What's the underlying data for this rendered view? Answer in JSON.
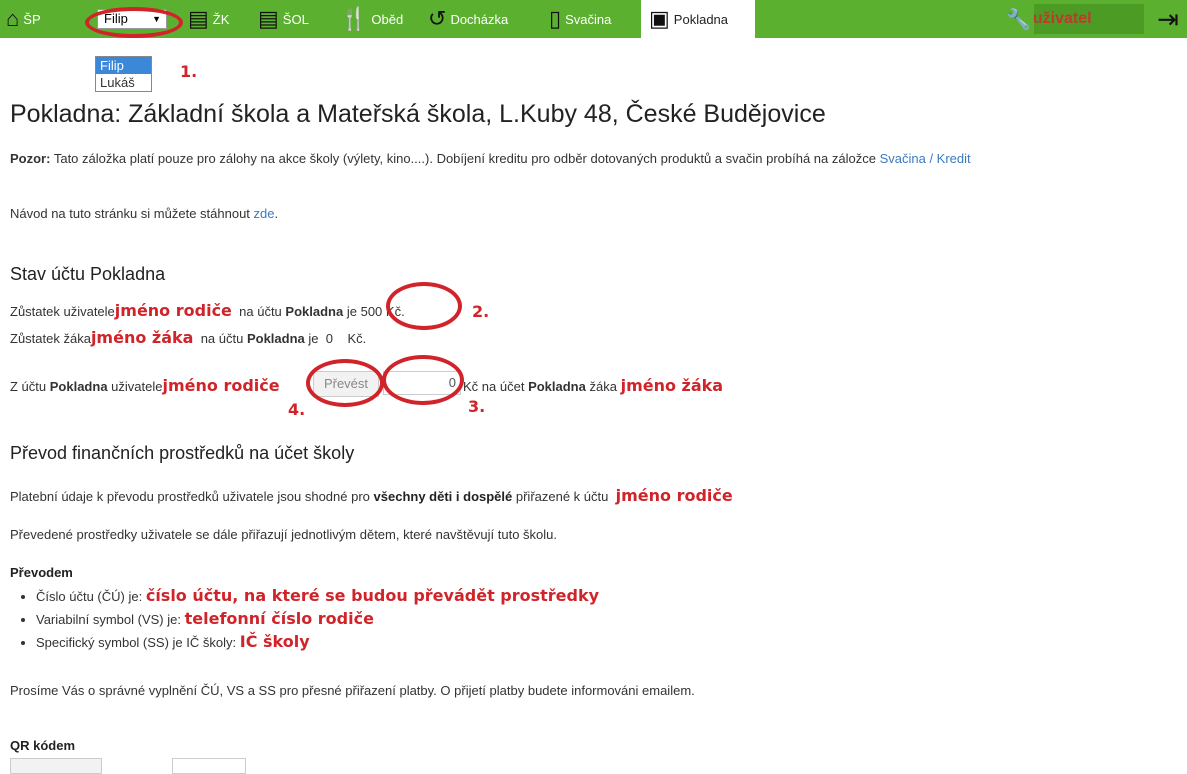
{
  "nav": {
    "home": "ŠP",
    "student_select_value": "Filip",
    "zk": "ŽK",
    "sol": "ŠOL",
    "obed": "Oběd",
    "dochazka": "Docházka",
    "svacina": "Svačina",
    "pokladna": "Pokladna",
    "user": "uživatel",
    "select_options": [
      "Filip",
      "Lukáš"
    ]
  },
  "marks": {
    "m1": "1.",
    "m2": "2.",
    "m3": "3.",
    "m4": "4."
  },
  "page": {
    "title": "Pokladna: Základní škola a Mateřská škola, L.Kuby 48, České Budějovice",
    "warning_label": "Pozor:",
    "warning_text": "Tato záložka platí pouze pro zálohy na akce školy (výlety, kino....). Dobíjení kreditu pro odběr dotovaných produktů a svačin probíhá na záložce",
    "warning_link": "Svačina / Kredit",
    "guide_text": "Návod na tuto stránku si můžete stáhnout",
    "guide_link": "zde",
    "section1_title": "Stav účtu Pokladna",
    "balance_user_prefix": "Zůstatek uživatele",
    "parent_name": "jméno rodiče",
    "on_account": "na účtu",
    "account_name": "Pokladna",
    "is": "je",
    "user_amount": "500 Kč.",
    "balance_student_prefix": "Zůstatek žáka",
    "student_name": "jméno žáka",
    "student_amount": "0",
    "student_currency": "Kč.",
    "transfer_from": "Z účtu",
    "transfer_user": "uživatele",
    "transfer_button": "Převést",
    "transfer_value": "0",
    "transfer_to": "Kč na účet",
    "transfer_student": "žáka",
    "section2_title": "Převod finančních prostředků na účet školy",
    "p1_a": "Platební údaje k převodu prostředků uživatele jsou shodné pro",
    "p1_b": "všechny děti i dospělé",
    "p1_c": "přiřazené k účtu",
    "p2": "Převedené prostředky uživatele se dále přiřazují jednotlivým dětem, které navštěvují tuto školu.",
    "prevodem": "Převodem",
    "li1_label": "Číslo účtu (ČÚ) je:",
    "li1_value": "číslo účtu, na které se budou převádět prostředky",
    "li2_label": "Variabilní symbol (VS) je:",
    "li2_value": "telefonní číslo rodiče",
    "li3_label": "Specifický symbol (SS) je IČ školy:",
    "li3_value": "IČ školy",
    "p3": "Prosíme Vás o správné vyplnění ČÚ, VS a SS pro přesné přiřazení platby. O přijetí platby budete informováni emailem.",
    "qr": "QR kódem"
  }
}
